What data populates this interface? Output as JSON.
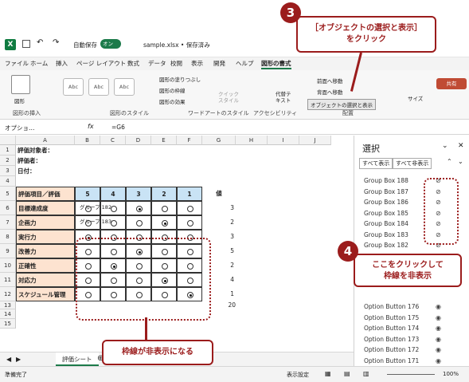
{
  "titlebar": {
    "autosave_label": "自動保存",
    "autosave_state": "オン",
    "filename": "sample.xlsx • 保存済み"
  },
  "menu": [
    "ファイル",
    "ホーム",
    "挿入",
    "ページ レイアウト",
    "数式",
    "データ",
    "校閲",
    "表示",
    "開発",
    "ヘルプ",
    "図形の書式"
  ],
  "ribbon": {
    "shape_label": "図形",
    "style_boxes": [
      "Abc",
      "Abc",
      "Abc"
    ],
    "fill": "図形の塗りつぶし",
    "outline": "図形の枠線",
    "effect": "図形の効果",
    "quick_style": "クイック\nスタイル",
    "alt_text": "代替テ\nキスト",
    "front": "前面へ移動",
    "back": "背面へ移動",
    "select_pane": "オブジェクトの選択と表示",
    "size": "サイズ",
    "groups": [
      "図形の挿入",
      "図形のスタイル",
      "ワードアートのスタイル",
      "アクセシビリティ",
      "配置"
    ],
    "share": "共有"
  },
  "formula": {
    "namebox": "オプショ…",
    "fx": "fx",
    "value": "=G6"
  },
  "columns": [
    "A",
    "B",
    "C",
    "D",
    "E",
    "F",
    "G",
    "H",
    "I",
    "J"
  ],
  "rows": [
    "1",
    "2",
    "3",
    "4",
    "5",
    "6",
    "7",
    "8",
    "9",
    "10",
    "11",
    "12",
    "13",
    "14",
    "15"
  ],
  "sheet": {
    "a1": "評価対象者：",
    "a2": "評価者：",
    "a3": "日付：",
    "header": "評価項目／評価",
    "scores": [
      "5",
      "4",
      "3",
      "2",
      "1"
    ],
    "g_header": "値",
    "items": [
      "目標達成度",
      "企画力",
      "実行力",
      "改善力",
      "正確性",
      "対応力",
      "スケジュール管理"
    ],
    "values": [
      "3",
      "2",
      "3",
      "5",
      "2",
      "4",
      "1"
    ],
    "total": "20",
    "group_labels": [
      "グループ 182",
      "グループ 183"
    ]
  },
  "pane": {
    "title": "選択",
    "show_all": "すべて表示",
    "hide_all": "すべて非表示",
    "items": [
      "Group Box 188",
      "Group Box 187",
      "Group Box 186",
      "Group Box 185",
      "Group Box 184",
      "Group Box 183",
      "Group Box 182"
    ],
    "items2": [
      "Option Button 176",
      "Option Button 175",
      "Option Button 174",
      "Option Button 173",
      "Option Button 172",
      "Option Button 171"
    ]
  },
  "sheettab": "評価シート",
  "status": {
    "ready": "準備完了",
    "display": "表示設定",
    "zoom": "100%"
  },
  "callouts": {
    "c3": "［オブジェクトの選択と表示］\nをクリック",
    "c4": "ここをクリックして\n枠線を非表示",
    "c5": "枠線が非表示になる",
    "n3": "3",
    "n4": "4"
  },
  "selected": [
    2,
    3,
    0,
    2,
    1,
    3,
    4
  ]
}
